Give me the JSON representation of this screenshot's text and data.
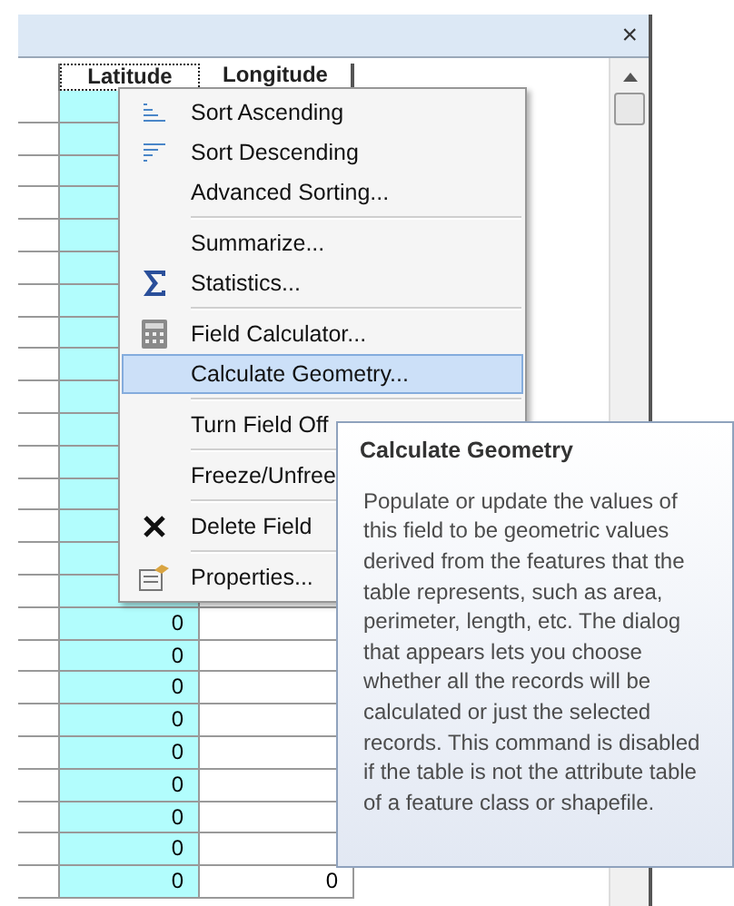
{
  "window": {
    "close": "×"
  },
  "table": {
    "columns": [
      {
        "label": "Latitude",
        "selected": true
      },
      {
        "label": "Longitude",
        "selected": false
      }
    ],
    "rows": [
      {},
      {},
      {},
      {},
      {},
      {},
      {},
      {},
      {},
      {},
      {},
      {},
      {},
      {},
      {},
      {},
      {
        "latitude": "0"
      },
      {
        "latitude": "0"
      },
      {
        "latitude": "0"
      },
      {
        "latitude": "0"
      },
      {
        "latitude": "0"
      },
      {
        "latitude": "0"
      },
      {
        "latitude": "0"
      },
      {
        "latitude": "0"
      },
      {
        "latitude": "0",
        "longitude": "0"
      }
    ]
  },
  "context_menu": [
    {
      "label": "Sort Ascending",
      "selected": false
    },
    {
      "label": "Sort Descending",
      "selected": false
    },
    {
      "label": "Advanced Sorting...",
      "selected": false
    },
    {
      "label": "Summarize...",
      "selected": false,
      "separator_before": true
    },
    {
      "label": "Statistics...",
      "selected": false
    },
    {
      "label": "Field Calculator...",
      "selected": false,
      "separator_before": true
    },
    {
      "label": "Calculate Geometry...",
      "selected": true
    },
    {
      "label": "Turn Field Off",
      "selected": false,
      "separator_before": true
    },
    {
      "label": "Freeze/Unfree",
      "selected": false,
      "separator_before": true
    },
    {
      "label": "Delete Field",
      "selected": false,
      "separator_before": true
    },
    {
      "label": "Properties...",
      "selected": false,
      "separator_before": true
    }
  ],
  "tooltip": {
    "title": "Calculate Geometry",
    "body": "Populate or update the values of this field to be geometric values derived from the features that the table represents, such as area, perimeter, length, etc. The dialog that appears lets you choose whether all the records will be calculated or just the selected records. This command is disabled if the table is not the attribute table of a feature class or shapefile."
  }
}
